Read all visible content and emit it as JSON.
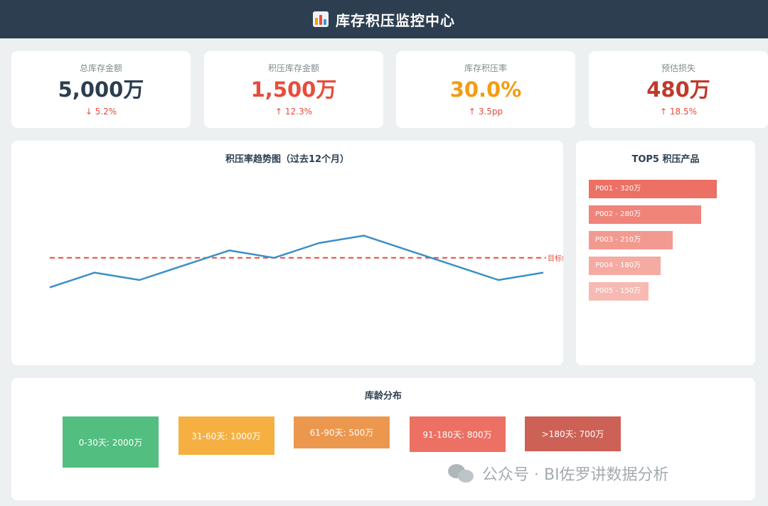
{
  "header": {
    "title": "库存积压监控中心"
  },
  "kpis": [
    {
      "label": "总库存金额",
      "value": "5,000万",
      "change": "↓ 5.2%",
      "color": "#2c3e50"
    },
    {
      "label": "积压库存金额",
      "value": "1,500万",
      "change": "↑ 12.3%",
      "color": "#e74c3c"
    },
    {
      "label": "库存积压率",
      "value": "30.0%",
      "change": "↑ 3.5pp",
      "color": "#f39c12"
    },
    {
      "label": "预估损失",
      "value": "480万",
      "change": "↑ 18.5%",
      "color": "#c0392b"
    }
  ],
  "trend": {
    "title": "积压率趋势图（过去12个月）",
    "target_label": "目标线"
  },
  "top5": {
    "title": "TOP5 积压产品",
    "items": [
      {
        "label": "P001 - 320万",
        "value": 320,
        "color": "#ec7063"
      },
      {
        "label": "P002 - 280万",
        "value": 280,
        "color": "#f0847a"
      },
      {
        "label": "P003 - 210万",
        "value": 210,
        "color": "#f39a90"
      },
      {
        "label": "P004 - 180万",
        "value": 180,
        "color": "#f5aaa2"
      },
      {
        "label": "P005 - 150万",
        "value": 150,
        "color": "#f7bab3"
      }
    ]
  },
  "age": {
    "title": "库龄分布",
    "buckets": [
      {
        "label": "0-30天: 2000万",
        "value": 2000,
        "color": "#52be80"
      },
      {
        "label": "31-60天: 1000万",
        "value": 1000,
        "color": "#f5b041"
      },
      {
        "label": "61-90天: 500万",
        "value": 500,
        "color": "#eb984e"
      },
      {
        "label": "91-180天: 800万",
        "value": 800,
        "color": "#ec7063"
      },
      {
        "label": ">180天: 700万",
        "value": 700,
        "color": "#cd6155"
      }
    ]
  },
  "watermark": {
    "text": "公众号 · BI佐罗讲数据分析"
  },
  "chart_data": {
    "type": "line",
    "title": "积压率趋势图（过去12个月）",
    "x": [
      1,
      2,
      3,
      4,
      5,
      6,
      7,
      8,
      9,
      10,
      11,
      12
    ],
    "series": [
      {
        "values": [
          24.0,
          26.0,
          25.0,
          27.0,
          29.0,
          28.0,
          30.0,
          31.0,
          29.0,
          27.0,
          25.0,
          26.0
        ]
      }
    ],
    "target": 28.0,
    "ylim": [
      15,
      40
    ],
    "grid": false,
    "xlabel": "",
    "ylabel": ""
  }
}
